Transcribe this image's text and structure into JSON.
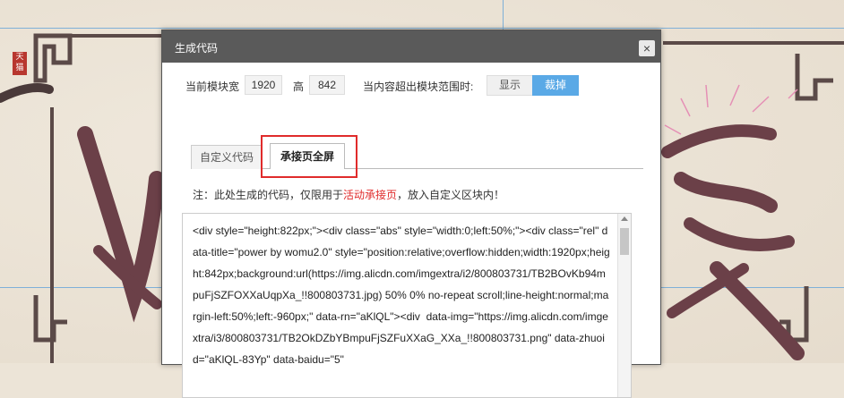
{
  "dialog": {
    "title": "生成代码",
    "close_glyph": "×"
  },
  "module": {
    "width_label": "当前模块宽",
    "width_value": "1920",
    "height_label": "高",
    "height_value": "842",
    "overflow_label": "当内容超出模块范围时:",
    "overflow_options": [
      "显示",
      "裁掉"
    ],
    "overflow_selected": "裁掉"
  },
  "tabs": [
    "自定义代码",
    "承接页全屏"
  ],
  "active_tab": "承接页全屏",
  "note": {
    "prefix": "注：此处生成的代码，仅限用于",
    "highlight": "活动承接页",
    "suffix": "，放入自定义区块内！"
  },
  "code_text": "<div style=\"height:822px;\"><div class=\"abs\" style=\"width:0;left:50%;\"><div class=\"rel\" data-title=\"power by womu2.0\" style=\"position:relative;overflow:hidden;width:1920px;height:842px;background:url(https://img.alicdn.com/imgextra/i2/800803731/TB2BOvKb94mpuFjSZFOXXaUqpXa_!!800803731.jpg) 50% 0% no-repeat scroll;line-height:normal;margin-left:50%;left:-960px;\" data-rn=\"aKlQL\"><div  data-img=\"https://img.alicdn.com/imgextra/i3/800803731/TB2OkDZbYBmpuFjSZFuXXaG_XXa_!!800803731.png\" data-zhuoid=\"aKlQL-83Yp\" data-baidu=\"5\"",
  "background": {
    "seal_text": "天猫",
    "colors": {
      "accent": "#5aa9e6",
      "alert": "#e02b2b",
      "titlebar": "#5a5a5a",
      "ink": "#5b4a48"
    }
  }
}
